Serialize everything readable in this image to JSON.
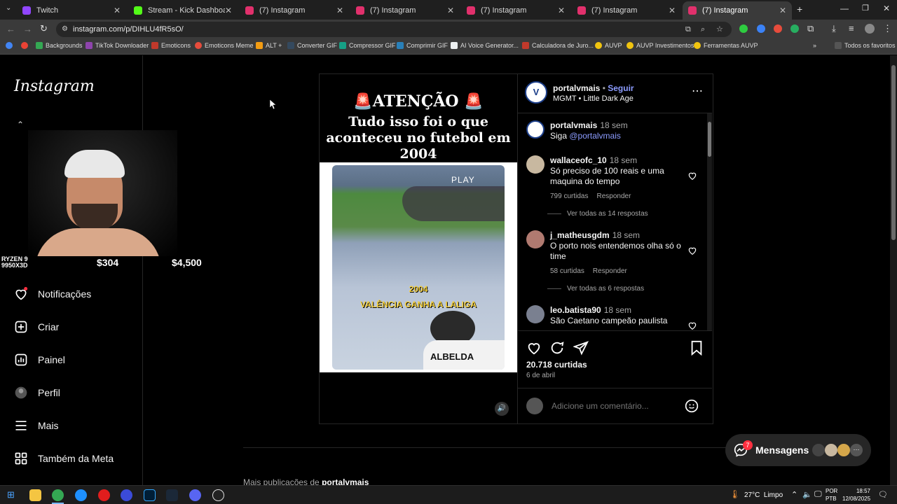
{
  "browser": {
    "tabs": [
      {
        "title": "Twitch",
        "color": "#9146ff"
      },
      {
        "title": "Stream - Kick Dashboard",
        "color": "#53fc18"
      },
      {
        "title": "(7) Instagram",
        "color": "#e1306c"
      },
      {
        "title": "(7) Instagram",
        "color": "#e1306c"
      },
      {
        "title": "(7) Instagram",
        "color": "#e1306c"
      },
      {
        "title": "(7) Instagram",
        "color": "#e1306c"
      },
      {
        "title": "(7) Instagram",
        "color": "#e1306c"
      }
    ],
    "url": "instagram.com/p/DIHLU4fR5sO/",
    "bookmarks": [
      "Backgrounds",
      "TikTok Downloader",
      "Emoticons",
      "Emoticons Meme",
      "ALT +",
      "Converter GIF",
      "Compressor GIF",
      "Comprimir GIF",
      "AI Voice Generator...",
      "Calculadora de Juro...",
      "AUVP",
      "AUVP Investimentos",
      "Ferramentas AUVP"
    ],
    "all_bookmarks": "Todos os favoritos"
  },
  "sidebar": {
    "logo": "Instagram",
    "overlay": {
      "label1": "RYZEN 9",
      "label2": "9950X3D",
      "amount1": "$304",
      "amount2": "$4,500"
    },
    "items": [
      {
        "label": "Notificações",
        "icon": "heart-icon"
      },
      {
        "label": "Criar",
        "icon": "plus-square-icon"
      },
      {
        "label": "Painel",
        "icon": "chart-icon"
      },
      {
        "label": "Perfil",
        "icon": "avatar-icon"
      },
      {
        "label": "Mais",
        "icon": "menu-icon"
      },
      {
        "label": "Também da Meta",
        "icon": "meta-icon"
      }
    ]
  },
  "post": {
    "headline1": "🚨ATENÇÃO 🚨",
    "headline2": "Tudo isso foi o que aconteceu no futebol em 2004",
    "video": {
      "play": "PLAY",
      "year": "2004",
      "caption": "VALÊNCIA GANHA A LALIGA",
      "jersey": "ALBELDA"
    },
    "author": "portalvmais",
    "follow": "Seguir",
    "dot": "•",
    "audio": "MGMT • Little Dark Age",
    "caption": {
      "user": "portalvmais",
      "time": "18 sem",
      "text_prefix": "Siga ",
      "mention": "@portalvmais"
    },
    "comments": [
      {
        "user": "wallaceofc_10",
        "time": "18 sem",
        "text": "Só preciso de 100 reais e uma maquina do tempo",
        "likes": "799 curtidas",
        "reply": "Responder",
        "replies": "Ver todas as 14 respostas"
      },
      {
        "user": "j_matheusgdm",
        "time": "18 sem",
        "text": "O porto nois entendemos olha só o time",
        "likes": "58 curtidas",
        "reply": "Responder",
        "replies": "Ver todas as 6 respostas"
      },
      {
        "user": "leo.batista90",
        "time": "18 sem",
        "text": "São Caetano campeão paulista"
      }
    ],
    "likes": "20.718 curtidas",
    "date": "6 de abril",
    "comment_placeholder": "Adicione um comentário..."
  },
  "more_posts": {
    "prefix": "Mais publicações de ",
    "user": "portalvmais"
  },
  "messages": {
    "label": "Mensagens",
    "badge": "7"
  },
  "taskbar": {
    "weather": "27°C  Limpo",
    "lang1": "POR",
    "lang2": "PTB",
    "time": "18:57",
    "date": "12/08/2025"
  }
}
